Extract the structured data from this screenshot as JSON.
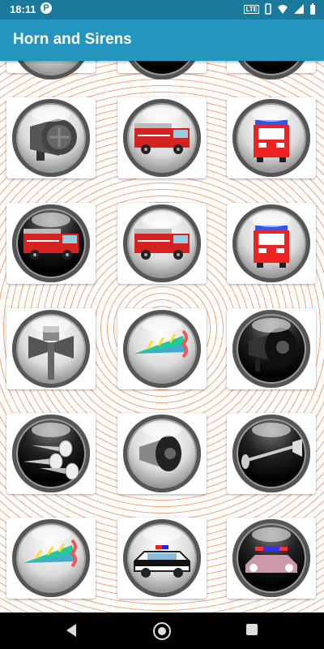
{
  "status": {
    "time": "18:11",
    "p_badge": "P",
    "lte": "LTE"
  },
  "app": {
    "title": "Horn and Sirens"
  },
  "grid": [
    [
      {
        "kind": "partial-light"
      },
      {
        "kind": "partial-dark"
      },
      {
        "kind": "partial-dark"
      }
    ],
    [
      {
        "kind": "siren-speaker",
        "dark": false
      },
      {
        "kind": "fire-truck-side",
        "dark": false
      },
      {
        "kind": "fire-truck-front",
        "dark": false
      }
    ],
    [
      {
        "kind": "fire-truck-side",
        "dark": true
      },
      {
        "kind": "fire-truck-side",
        "dark": false
      },
      {
        "kind": "fire-truck-front",
        "dark": false
      }
    ],
    [
      {
        "kind": "pa-speaker-pole",
        "dark": false
      },
      {
        "kind": "party-horn",
        "dark": false
      },
      {
        "kind": "horn-speaker",
        "dark": true
      }
    ],
    [
      {
        "kind": "air-horns",
        "dark": true
      },
      {
        "kind": "megaphone",
        "dark": false
      },
      {
        "kind": "trumpet-horn",
        "dark": true
      }
    ],
    [
      {
        "kind": "party-horn",
        "dark": false
      },
      {
        "kind": "police-car",
        "dark": false
      },
      {
        "kind": "police-car-night",
        "dark": true
      }
    ]
  ],
  "nav": {
    "back": "back-icon",
    "home": "home-icon",
    "recents": "recents-icon"
  }
}
